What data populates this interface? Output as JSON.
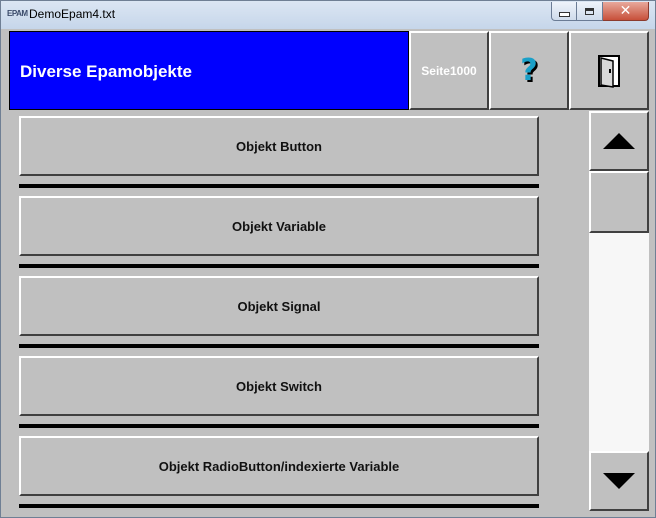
{
  "window": {
    "title": "DemoEpam4.txt",
    "icon": "EPAM",
    "minimize_icon": "minimize-icon",
    "maximize_icon": "maximize-icon",
    "close_icon": "close-icon",
    "close_glyph": "✕"
  },
  "header": {
    "title": "Diverse Epamobjekte",
    "title_bg": "#0000ff",
    "page_label": "Seite1000",
    "help_icon": "question-mark-icon",
    "help_glyph": "?",
    "exit_icon": "door-exit-icon"
  },
  "list": {
    "items": [
      {
        "label": "Objekt Button"
      },
      {
        "label": "Objekt Variable"
      },
      {
        "label": "Objekt Signal"
      },
      {
        "label": "Objekt Switch"
      },
      {
        "label": "Objekt RadioButton/indexierte Variable"
      }
    ]
  },
  "scrollbar": {
    "up_icon": "arrow-up-icon",
    "down_icon": "arrow-down-icon"
  },
  "colors": {
    "face": "#c0c0c0",
    "accent": "#0000ff",
    "help": "#1aa0c8"
  }
}
